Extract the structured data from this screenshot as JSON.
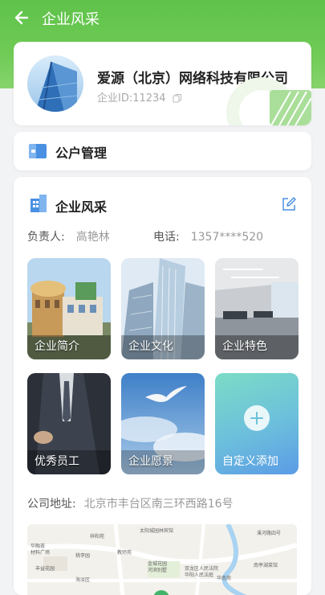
{
  "header": {
    "title": "企业风采"
  },
  "company": {
    "name": "爱源（北京）网络科技有限公司",
    "id_label": "企业ID:11234"
  },
  "account": {
    "label": "公户管理"
  },
  "showcase": {
    "title": "企业风采",
    "manager_label": "负责人:",
    "manager_name": "高艳林",
    "phone_label": "电话:",
    "phone": "1357****520",
    "tiles": [
      {
        "label": "企业简介"
      },
      {
        "label": "企业文化"
      },
      {
        "label": "企业特色"
      },
      {
        "label": "优秀员工"
      },
      {
        "label": "企业愿景"
      },
      {
        "label": "自定义添加"
      }
    ],
    "address_label": "公司地址:",
    "address": "北京市丰台区南三环西路16号"
  },
  "map": {
    "labels": [
      "太阳城园林宾馆",
      "祥和苑",
      "华融荟",
      "材料广场",
      "桃李园",
      "教师苑",
      "丰益花园",
      "金城花园",
      "河滨别墅",
      "双龙区人民法院",
      "华阳人民法庭",
      "华南苑",
      "海淡区",
      "南亭湖菜馆",
      "溪河路四号"
    ]
  },
  "colors": {
    "brand_green": "#5fc24a",
    "accent_blue": "#4a90e2",
    "add_tile_start": "#7bdcc6",
    "add_tile_end": "#5b9be6"
  },
  "icons": {
    "back": "arrow-left-icon",
    "copy": "copy-icon",
    "account": "wallet-card-icon",
    "showcase": "building-icon",
    "edit": "edit-icon",
    "add": "plus-icon"
  }
}
